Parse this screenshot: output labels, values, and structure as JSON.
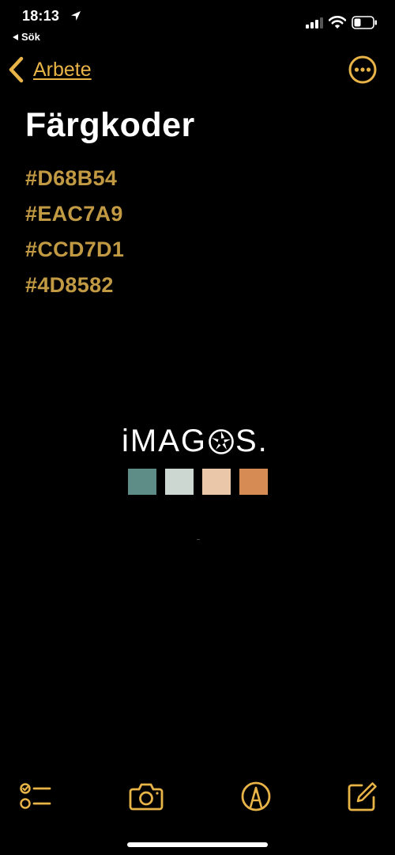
{
  "status_bar": {
    "time": "18:13",
    "back_label": "Sök"
  },
  "nav": {
    "back_label": "Arbete",
    "back_icon": "chevron-left-icon",
    "more_icon": "ellipsis-circle-icon"
  },
  "note": {
    "title": "Färgkoder",
    "lines": [
      "#D68B54",
      "#EAC7A9",
      "#CCD7D1",
      "#4D8582"
    ]
  },
  "embedded_image": {
    "logo_prefix": "iMAG",
    "logo_suffix": "S.",
    "swatches": [
      "#5E8D88",
      "#CCD7D1",
      "#EAC7A9",
      "#D68B54"
    ]
  },
  "toolbar": {
    "items": [
      "checklist-icon",
      "camera-icon",
      "markup-pen-icon",
      "compose-icon"
    ]
  },
  "colors": {
    "accent": "#E8B347",
    "note_text": "#C19A43",
    "background": "#000000"
  }
}
